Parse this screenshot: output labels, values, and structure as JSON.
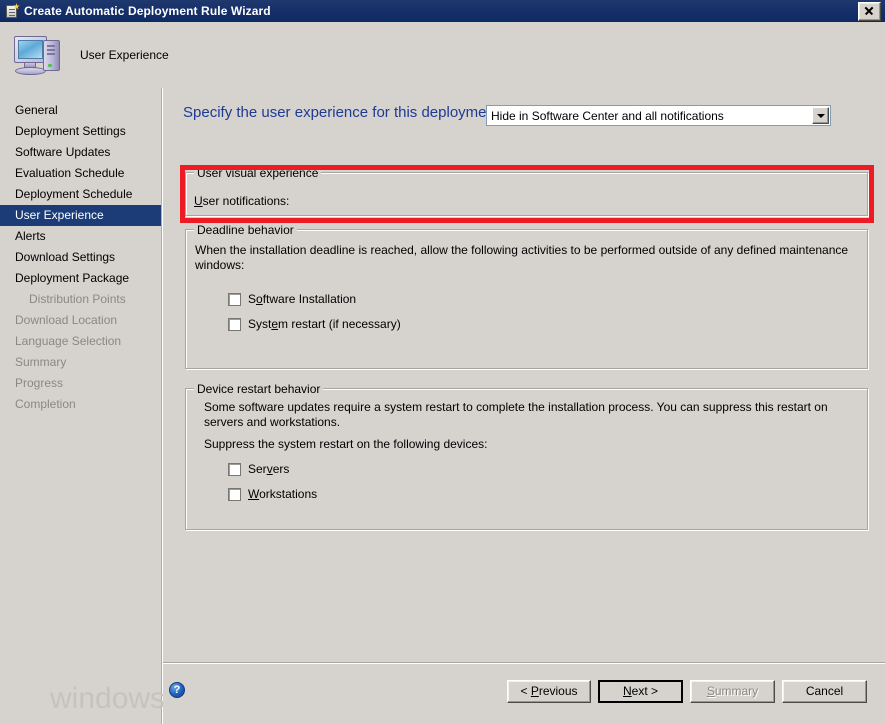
{
  "window": {
    "title": "Create Automatic Deployment Rule Wizard",
    "close_label": "Close",
    "header_title": "User Experience"
  },
  "sidebar": {
    "items": [
      {
        "label": "General",
        "state": "enabled",
        "indent": false
      },
      {
        "label": "Deployment Settings",
        "state": "enabled",
        "indent": false
      },
      {
        "label": "Software Updates",
        "state": "enabled",
        "indent": false
      },
      {
        "label": "Evaluation Schedule",
        "state": "enabled",
        "indent": false
      },
      {
        "label": "Deployment Schedule",
        "state": "enabled",
        "indent": false
      },
      {
        "label": "User Experience",
        "state": "selected",
        "indent": false
      },
      {
        "label": "Alerts",
        "state": "enabled",
        "indent": false
      },
      {
        "label": "Download Settings",
        "state": "enabled",
        "indent": false
      },
      {
        "label": "Deployment Package",
        "state": "enabled",
        "indent": false
      },
      {
        "label": "Distribution Points",
        "state": "disabled",
        "indent": true
      },
      {
        "label": "Download Location",
        "state": "disabled",
        "indent": false
      },
      {
        "label": "Language Selection",
        "state": "disabled",
        "indent": false
      },
      {
        "label": "Summary",
        "state": "disabled",
        "indent": false
      },
      {
        "label": "Progress",
        "state": "disabled",
        "indent": false
      },
      {
        "label": "Completion",
        "state": "disabled",
        "indent": false
      }
    ]
  },
  "main": {
    "heading": "Specify the user experience for this deployment",
    "visual_group": {
      "title": "User visual experience",
      "notifications_label": "User notifications:",
      "notifications_label_accel": "U",
      "notifications_value": "Hide in Software Center and all notifications"
    },
    "deadline_group": {
      "title": "Deadline behavior",
      "description": "When the installation deadline is reached, allow the following activities to be performed outside of any defined maintenance windows:",
      "checkboxes": [
        {
          "label": "Software Installation",
          "accel": "o",
          "checked": false
        },
        {
          "label": "System restart (if necessary)",
          "accel": "e",
          "checked": false
        }
      ]
    },
    "restart_group": {
      "title": "Device restart behavior",
      "description": "Some software updates require a system restart to complete the installation process.  You can suppress this restart on servers and workstations.",
      "suppress_label": "Suppress the system restart on the following devices:",
      "checkboxes": [
        {
          "label": "Servers",
          "accel": "v",
          "checked": false
        },
        {
          "label": "Workstations",
          "accel": "W",
          "checked": false
        }
      ]
    }
  },
  "footer": {
    "help_glyph": "?",
    "buttons": [
      {
        "label": "< Previous",
        "state": "enabled"
      },
      {
        "label": "Next >",
        "state": "default"
      },
      {
        "label": "Summary",
        "state": "disabled"
      },
      {
        "label": "Cancel",
        "state": "enabled"
      }
    ]
  },
  "watermark": "windows-noob.com",
  "colors": {
    "titlebar": "#16306a",
    "window_face": "#d6d3ce",
    "heading_blue": "#1f3a93",
    "selection_blue": "#1c3c78",
    "highlight_red": "#ed1c24",
    "disabled_text": "#8c8880"
  }
}
